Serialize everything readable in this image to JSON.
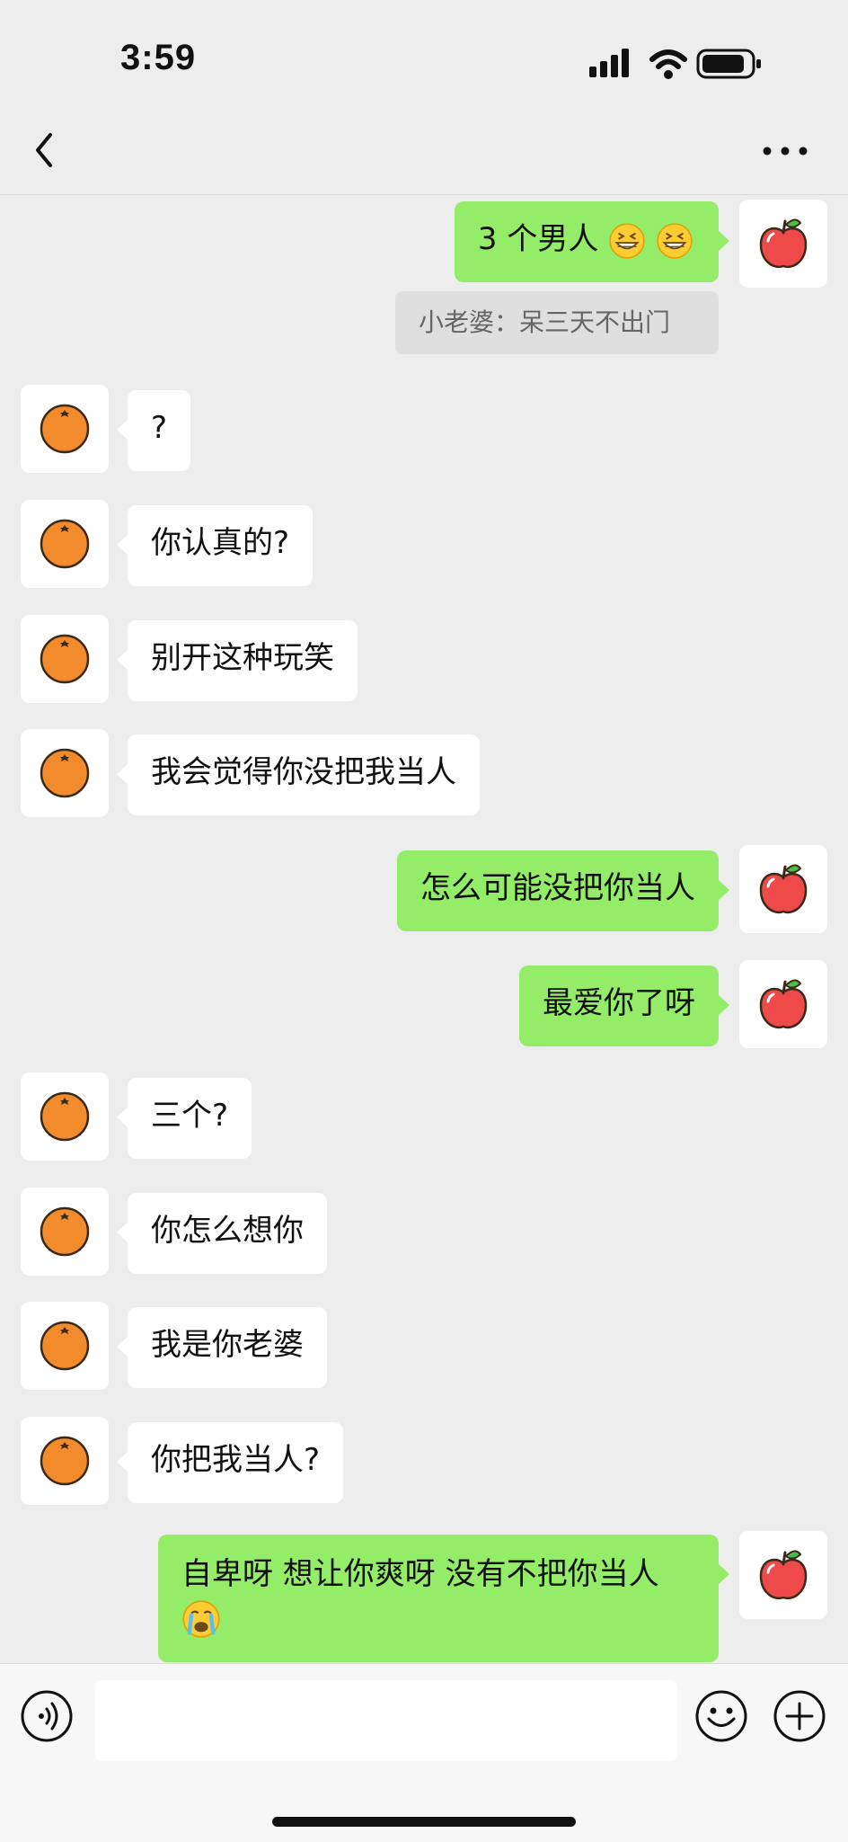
{
  "status_bar": {
    "time": "3:59"
  },
  "nav_bar": {
    "title": "",
    "back_icon": "chevron-left-icon",
    "more_icon": "ellipsis-icon"
  },
  "colors": {
    "background": "#ededed",
    "sent_bubble": "#95ec69",
    "received_bubble": "#ffffff"
  },
  "messages": [
    {
      "side": "right",
      "avatar": "apple-avatar",
      "text": "3 个男人",
      "emojis": [
        "grinning-squint-emoji",
        "grinning-squint-emoji"
      ]
    },
    {
      "side": "quote",
      "text": "小老婆：呆三天不出门"
    },
    {
      "side": "left",
      "avatar": "orange-avatar",
      "text": "?"
    },
    {
      "side": "left",
      "avatar": "orange-avatar",
      "text": "你认真的?"
    },
    {
      "side": "left",
      "avatar": "orange-avatar",
      "text": "别开这种玩笑"
    },
    {
      "side": "left",
      "avatar": "orange-avatar",
      "text": "我会觉得你没把我当人"
    },
    {
      "side": "right",
      "avatar": "apple-avatar",
      "text": "怎么可能没把你当人"
    },
    {
      "side": "right",
      "avatar": "apple-avatar",
      "text": "最爱你了呀"
    },
    {
      "side": "left",
      "avatar": "orange-avatar",
      "text": "三个?"
    },
    {
      "side": "left",
      "avatar": "orange-avatar",
      "text": "你怎么想你"
    },
    {
      "side": "left",
      "avatar": "orange-avatar",
      "text": "我是你老婆"
    },
    {
      "side": "left",
      "avatar": "orange-avatar",
      "text": "你把我当人?"
    },
    {
      "side": "right",
      "avatar": "apple-avatar",
      "text": "自卑呀 想让你爽呀 没有不把你当人",
      "emojis": [
        "crying-emoji"
      ]
    }
  ],
  "input_bar": {
    "voice_icon": "voice-icon",
    "input_value": "",
    "emoji_icon": "smiley-icon",
    "plus_icon": "plus-circle-icon"
  }
}
